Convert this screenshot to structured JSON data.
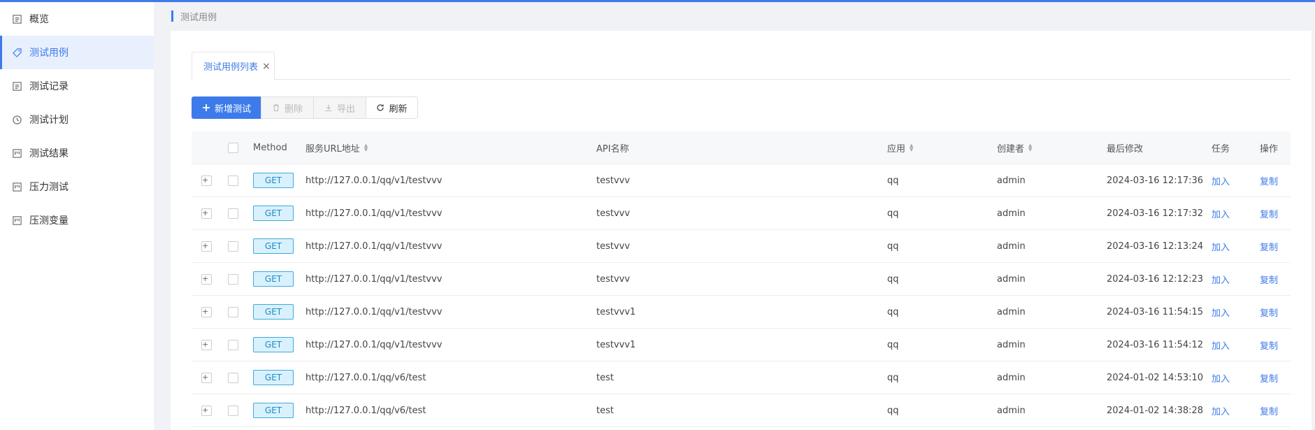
{
  "colors": {
    "accent": "#3d7bea",
    "badge_bg": "#d9f1fd",
    "badge_border": "#3fa9dd"
  },
  "sidebar": {
    "items": [
      {
        "label": "概览",
        "icon": "list-icon",
        "active": false
      },
      {
        "label": "测试用例",
        "icon": "tag-icon",
        "active": true
      },
      {
        "label": "测试记录",
        "icon": "list-icon",
        "active": false
      },
      {
        "label": "测试计划",
        "icon": "clock-icon",
        "active": false
      },
      {
        "label": "测试结果",
        "icon": "board-icon",
        "active": false
      },
      {
        "label": "压力测试",
        "icon": "board-icon",
        "active": false
      },
      {
        "label": "压测变量",
        "icon": "board-icon",
        "active": false
      }
    ]
  },
  "breadcrumb": {
    "current": "测试用例"
  },
  "tabs": [
    {
      "label": "测试用例列表",
      "close": "×"
    }
  ],
  "toolbar": {
    "add_label": "新增测试",
    "delete_label": "删除",
    "export_label": "导出",
    "refresh_label": "刷新"
  },
  "table": {
    "headers": {
      "method": "Method",
      "url": "服务URL地址",
      "api": "API名称",
      "app": "应用",
      "creator": "创建者",
      "modified": "最后修改",
      "task": "任务",
      "op": "操作"
    },
    "rows": [
      {
        "expand": "+",
        "method": "GET",
        "url": "http://127.0.0.1/qq/v1/testvvv",
        "api": "testvvv",
        "app": "qq",
        "creator": "admin",
        "modified": "2024-03-16 12:17:36",
        "task": "加入",
        "op": "复制"
      },
      {
        "expand": "+",
        "method": "GET",
        "url": "http://127.0.0.1/qq/v1/testvvv",
        "api": "testvvv",
        "app": "qq",
        "creator": "admin",
        "modified": "2024-03-16 12:17:32",
        "task": "加入",
        "op": "复制"
      },
      {
        "expand": "+",
        "method": "GET",
        "url": "http://127.0.0.1/qq/v1/testvvv",
        "api": "testvvv",
        "app": "qq",
        "creator": "admin",
        "modified": "2024-03-16 12:13:24",
        "task": "加入",
        "op": "复制"
      },
      {
        "expand": "+",
        "method": "GET",
        "url": "http://127.0.0.1/qq/v1/testvvv",
        "api": "testvvv",
        "app": "qq",
        "creator": "admin",
        "modified": "2024-03-16 12:12:23",
        "task": "加入",
        "op": "复制"
      },
      {
        "expand": "+",
        "method": "GET",
        "url": "http://127.0.0.1/qq/v1/testvvv",
        "api": "testvvv1",
        "app": "qq",
        "creator": "admin",
        "modified": "2024-03-16 11:54:15",
        "task": "加入",
        "op": "复制"
      },
      {
        "expand": "+",
        "method": "GET",
        "url": "http://127.0.0.1/qq/v1/testvvv",
        "api": "testvvv1",
        "app": "qq",
        "creator": "admin",
        "modified": "2024-03-16 11:54:12",
        "task": "加入",
        "op": "复制"
      },
      {
        "expand": "+",
        "method": "GET",
        "url": "http://127.0.0.1/qq/v6/test",
        "api": "test",
        "app": "qq",
        "creator": "admin",
        "modified": "2024-01-02 14:53:10",
        "task": "加入",
        "op": "复制"
      },
      {
        "expand": "+",
        "method": "GET",
        "url": "http://127.0.0.1/qq/v6/test",
        "api": "test",
        "app": "qq",
        "creator": "admin",
        "modified": "2024-01-02 14:38:28",
        "task": "加入",
        "op": "复制"
      }
    ]
  }
}
